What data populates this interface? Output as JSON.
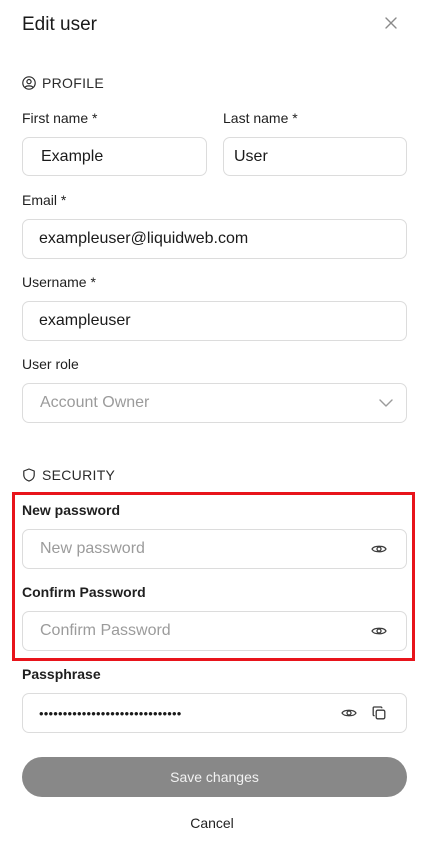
{
  "header": {
    "title": "Edit user",
    "close_icon": "close-icon"
  },
  "profile": {
    "section_label": "PROFILE",
    "section_icon": "user-circle-icon",
    "first_name": {
      "label": "First name *",
      "value": "Example"
    },
    "last_name": {
      "label": "Last name *",
      "value": "User"
    },
    "email": {
      "label": "Email *",
      "value": "exampleuser@liquidweb.com"
    },
    "username": {
      "label": "Username *",
      "value": "exampleuser"
    },
    "user_role": {
      "label": "User role",
      "value": "Account Owner",
      "icon": "chevron-down-icon"
    }
  },
  "security": {
    "section_label": "SECURITY",
    "section_icon": "shield-icon",
    "new_password": {
      "label": "New password",
      "placeholder": "New password",
      "icon": "eye-icon"
    },
    "confirm_password": {
      "label": "Confirm Password",
      "placeholder": "Confirm Password",
      "icon": "eye-icon"
    },
    "passphrase": {
      "label": "Passphrase",
      "value": "••••••••••••••••••••••••••••••",
      "icons": [
        "eye-icon",
        "copy-icon"
      ]
    }
  },
  "actions": {
    "save_label": "Save changes",
    "cancel_label": "Cancel"
  },
  "colors": {
    "highlight": "#e8141b",
    "save_button_bg": "#888888",
    "field_border": "#dcdcdc",
    "placeholder": "#9b9b9b"
  }
}
